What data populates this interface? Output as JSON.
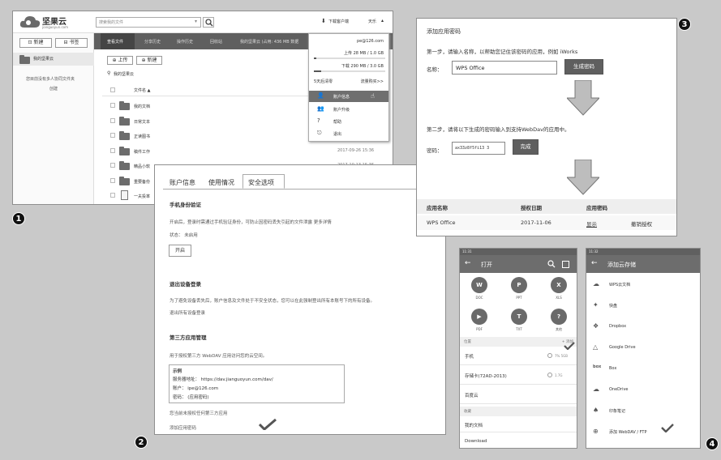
{
  "badges": {
    "p1": "1",
    "p2": "2",
    "p3": "3",
    "p4": "4"
  },
  "p1": {
    "logo_title": "坚果云",
    "logo_sub": "jianguoyun.com",
    "search_placeholder": "搜索我的文件",
    "download_client": "下载客户端",
    "user_menu": "天乐",
    "btn_new": "新建",
    "btn_bookmark": "书签",
    "tabs": [
      "查看文件",
      "分享历史",
      "操作历史",
      "回收站"
    ],
    "breadcrumb": "我的坚果云 (占用: 436 MB 数据",
    "sidebar_item": "我的坚果云",
    "sidebar_empty": "您目前没有多人协同文件夹",
    "sidebar_create": "创建",
    "upload": "上传",
    "new": "新建",
    "location": "我的坚果云",
    "col_name": "文件名 ▲",
    "files": [
      "我的文档",
      "日常文本",
      "正读图书",
      "稿件工作",
      "精品小软",
      "重要备份",
      "一夫投率"
    ],
    "times": [
      "2017-09-26 15:36",
      "2017-10-13 15:36"
    ],
    "dropdown": {
      "email": "pe@126.com",
      "upload_quota": "上传 28 MB / 1.0 GB",
      "upload_frac": 0.03,
      "download_quota": "下载 290 MB / 3.0 GB",
      "download_frac": 0.1,
      "reset": "5天后清零",
      "buy": "流量购买>>",
      "items": [
        "账户信息",
        "账户升级",
        "帮助",
        "退出"
      ]
    }
  },
  "p2": {
    "tabs": [
      "账户信息",
      "使用情况",
      "安全选项"
    ],
    "phone_title": "手机身份验证",
    "phone_desc": "开启后，登录时需通过手机验证身份，可防止因密码丢失引起的文件泄露 更多详情",
    "status": "状态： 未启用",
    "enable": "开启",
    "logout_title": "退出设备登录",
    "logout_desc": "为了避免设备丢失后，账户信息及文件处于不安全状态，您可以在此强制登出所有本账号下的所有设备。",
    "logout_link": "退出所有设备登录",
    "third_title": "第三方应用管理",
    "third_desc": "用于授权第三方 WebDAV 应用访问您的云空间。",
    "example_title": "示例",
    "example_lines": [
      "服务器地址： https://dav.jianguoyun.com/dav/",
      "账户： ipe@126.com",
      "密码： (应用密码)"
    ],
    "no_auth": "您当前未授权任何第三方应用",
    "add_app": "添加应用密码"
  },
  "p3": {
    "title": "添加应用密码",
    "step1": "第一步，请输入名称，以帮助您记住该密码的应用，例如 iWorks",
    "name_label": "名称：",
    "name_value": "WPS Office",
    "gen_btn": "生成密码",
    "step2": "第二步，请将以下生成的密码输入到支持WebDav的应用中。",
    "pw_label": "密码：",
    "pw_value": "ax33z8f5fi13  3",
    "done": "完成",
    "cols": [
      "应用名称",
      "授权日期",
      "应用密码"
    ],
    "row": [
      "WPS Office",
      "2017-11-06",
      "显示",
      "撤销授权"
    ]
  },
  "p4": {
    "left": {
      "status_time": "11:31",
      "title": "打开",
      "types": [
        "DOC",
        "PPT",
        "XLS",
        "PDF",
        "TXT",
        "其他"
      ],
      "section1": "位置",
      "add": "+ 添加",
      "rows": [
        {
          "name": "手机",
          "size": "7% 5GB"
        },
        {
          "name": "存储卡(72AD-2013)",
          "size": "1.7G"
        },
        {
          "name": "百度云",
          "size": ""
        }
      ],
      "section2": "收藏",
      "rows2": [
        "我的文档",
        "Download"
      ]
    },
    "right": {
      "status_time": "11:32",
      "title": "添加云存储",
      "items": [
        "WPS云文档",
        "快盘",
        "Dropbox",
        "Google Drive",
        "Box",
        "OneDrive",
        "印象笔记",
        "添加 WebDAV / FTP"
      ]
    }
  },
  "colors": {
    "accent_dark": "#5f5f5f",
    "highlight": "#6f6f6f"
  }
}
